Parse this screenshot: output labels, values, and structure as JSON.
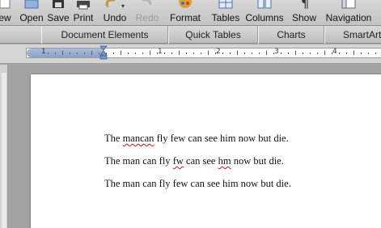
{
  "toolbar": {
    "items": [
      {
        "label": "ew",
        "icon": "new-document-icon",
        "disabled": false
      },
      {
        "label": "Open",
        "icon": "open-folder-icon",
        "disabled": false
      },
      {
        "label": "Save",
        "icon": "save-icon",
        "disabled": false
      },
      {
        "label": "Print",
        "icon": "printer-icon",
        "disabled": false
      },
      {
        "label": "Undo",
        "icon": "undo-icon",
        "disabled": false
      },
      {
        "label": "Redo",
        "icon": "redo-icon",
        "disabled": true
      },
      {
        "label": "Format",
        "icon": "format-palette-icon",
        "disabled": false
      },
      {
        "label": "Tables",
        "icon": "table-icon",
        "disabled": false
      },
      {
        "label": "Columns",
        "icon": "columns-icon",
        "disabled": false
      },
      {
        "label": "Show",
        "icon": "pilcrow-icon",
        "disabled": false
      },
      {
        "label": "Navigation",
        "icon": "navigation-pane-icon",
        "disabled": false
      }
    ]
  },
  "ribbon": {
    "tabs": [
      "Document Elements",
      "Quick Tables",
      "Charts",
      "SmartArt"
    ]
  },
  "ruler": {
    "numbers": [
      "1",
      "1",
      "2",
      "3",
      "4"
    ]
  },
  "document": {
    "lines": [
      {
        "segments": [
          {
            "text": "The ",
            "error": false
          },
          {
            "text": "mancan",
            "error": true
          },
          {
            "text": " fly few can see him now but die.",
            "error": false
          }
        ]
      },
      {
        "segments": [
          {
            "text": "The man can fly ",
            "error": false
          },
          {
            "text": "fw",
            "error": true
          },
          {
            "text": " can see ",
            "error": false
          },
          {
            "text": "hm",
            "error": true
          },
          {
            "text": " now but die.",
            "error": false
          }
        ]
      },
      {
        "segments": [
          {
            "text": "The man can fly few can see him now but die.",
            "error": false
          }
        ]
      }
    ]
  }
}
